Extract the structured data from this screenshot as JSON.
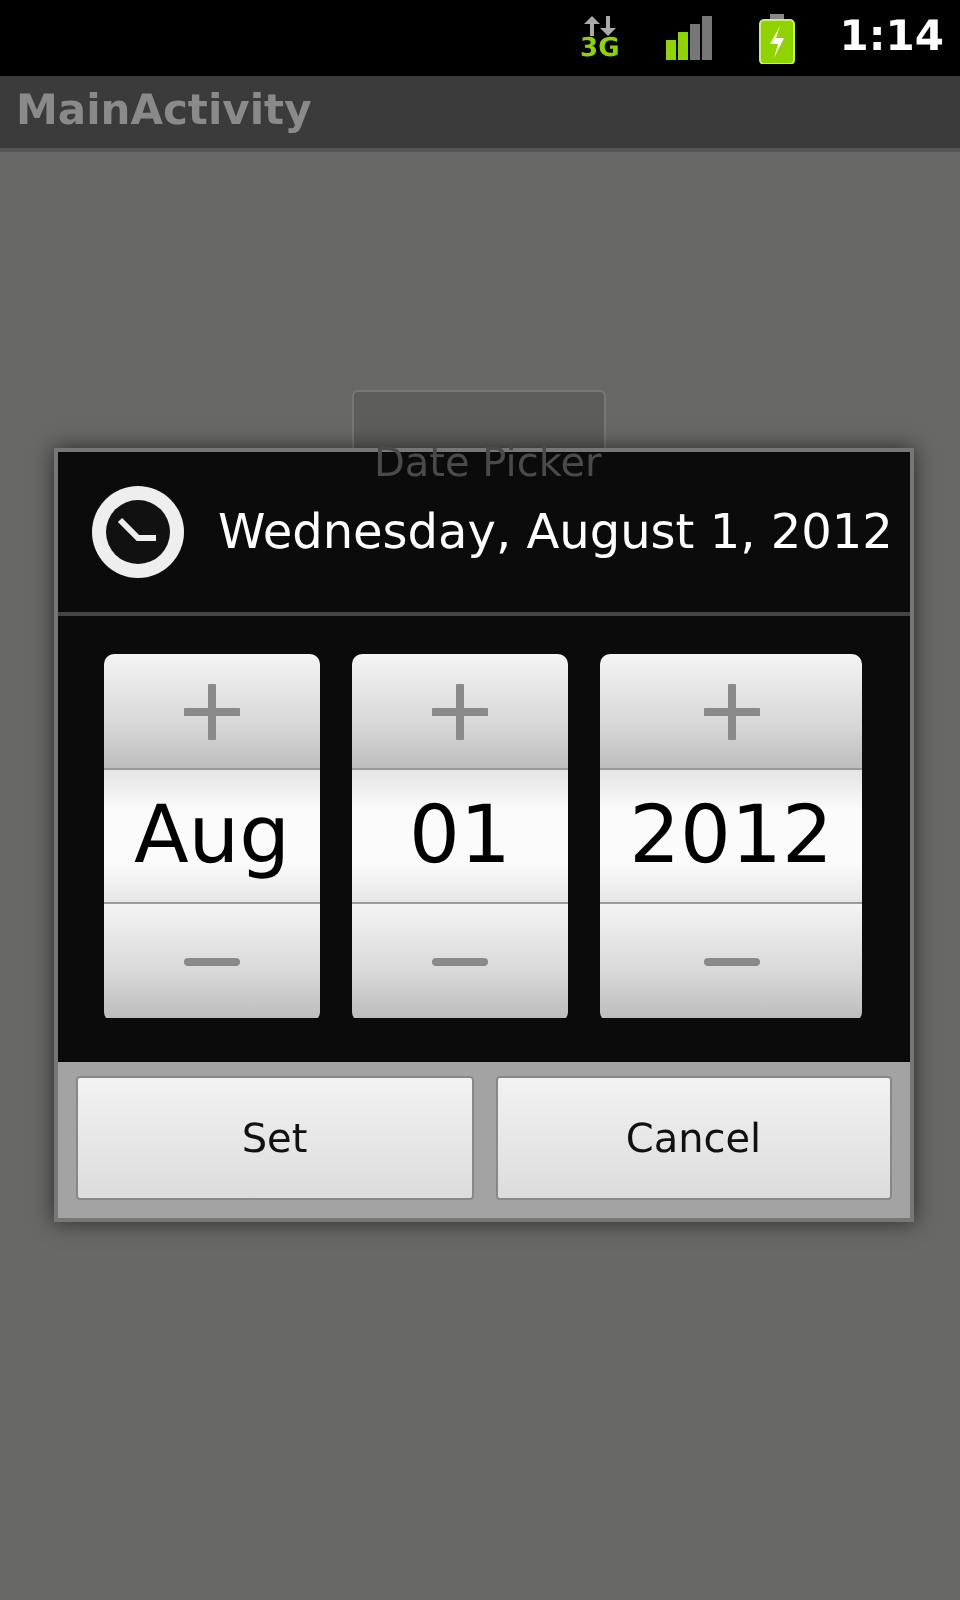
{
  "status_bar": {
    "network": "3G",
    "time": "1:14"
  },
  "app_bar": {
    "title": "MainActivity"
  },
  "screen_button": {
    "label": "Date Picker"
  },
  "dialog": {
    "title": "Wednesday, August 1, 2012",
    "pickers": [
      {
        "kind": "month",
        "value": "Aug"
      },
      {
        "kind": "day",
        "value": "01"
      },
      {
        "kind": "year",
        "value": "2012"
      }
    ],
    "buttons": [
      {
        "label": "Set"
      },
      {
        "label": "Cancel"
      }
    ]
  }
}
